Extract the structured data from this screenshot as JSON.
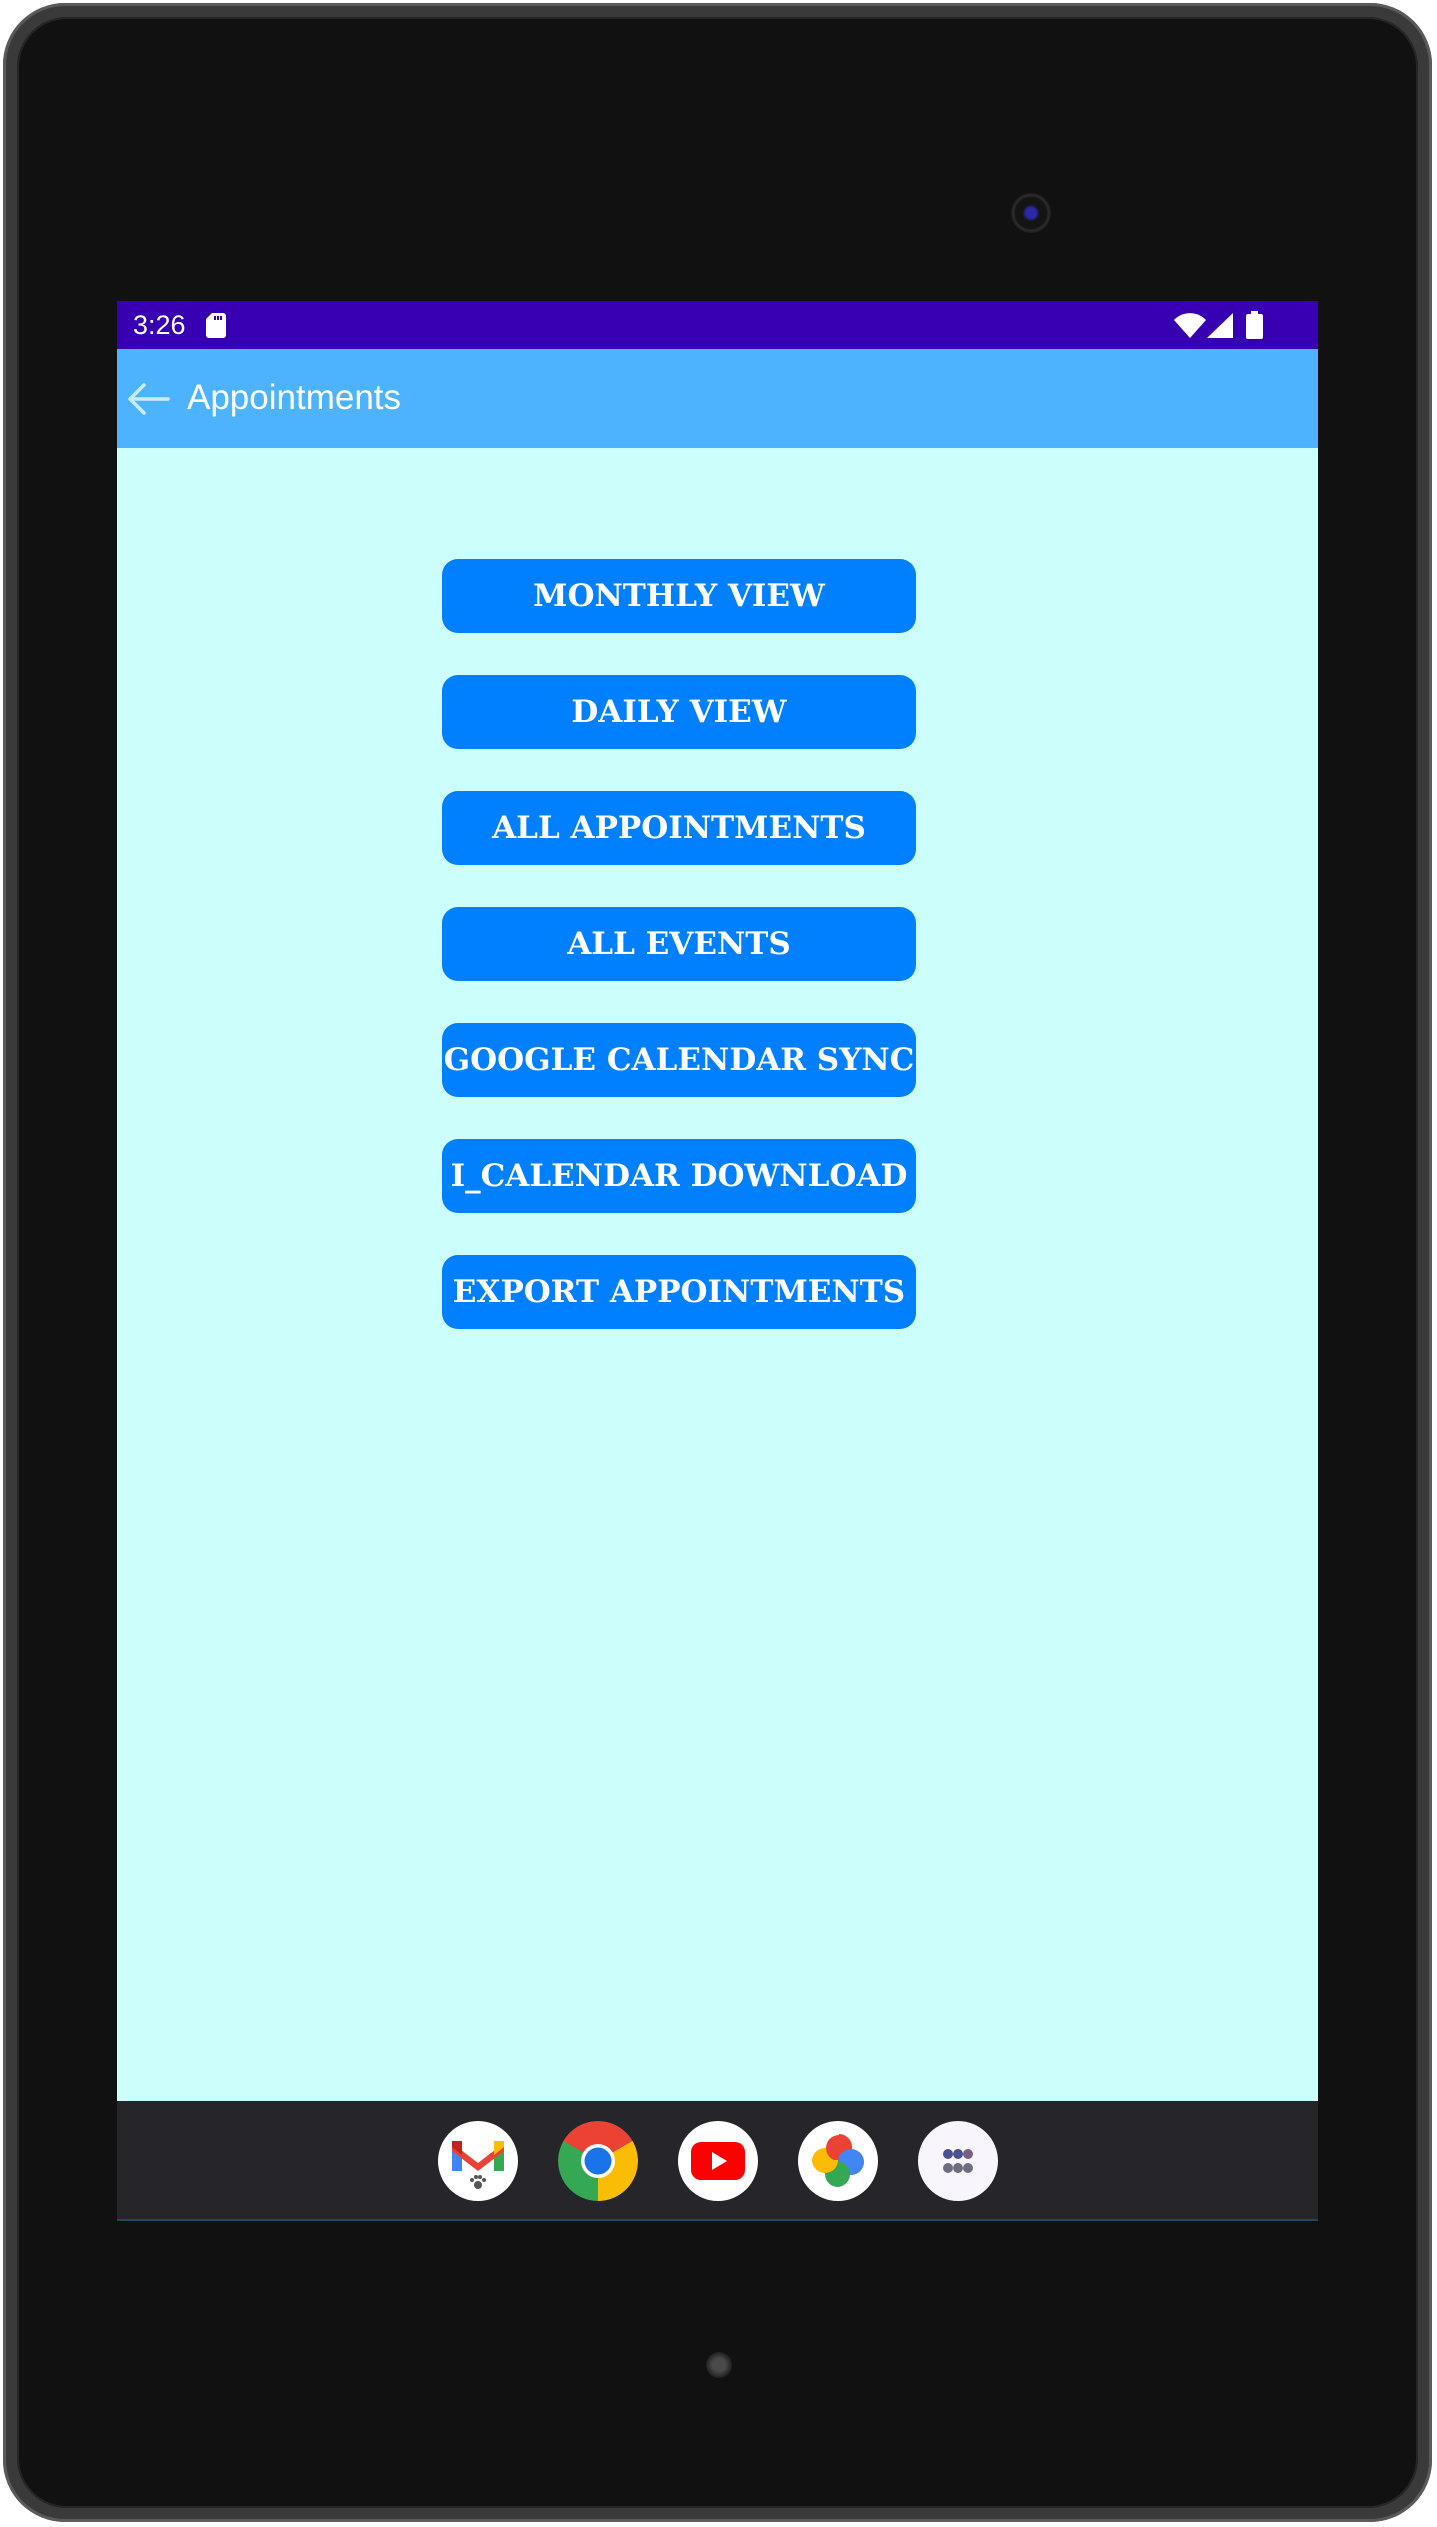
{
  "status_bar": {
    "time": "3:26",
    "icons": [
      "sd-card-icon",
      "wifi-icon",
      "signal-icon",
      "battery-icon"
    ]
  },
  "app_bar": {
    "back_icon": "arrow-left-icon",
    "title": "Appointments"
  },
  "menu": {
    "buttons": [
      {
        "label": "MONTHLY VIEW"
      },
      {
        "label": "DAILY VIEW"
      },
      {
        "label": "ALL APPOINTMENTS"
      },
      {
        "label": "ALL EVENTS"
      },
      {
        "label": "GOOGLE CALENDAR SYNC"
      },
      {
        "label": "I_CALENDAR DOWNLOAD"
      },
      {
        "label": "EXPORT APPOINTMENTS"
      }
    ]
  },
  "dock": {
    "apps": [
      {
        "name": "Gmail",
        "icon": "gmail-icon"
      },
      {
        "name": "Chrome",
        "icon": "chrome-icon"
      },
      {
        "name": "YouTube",
        "icon": "youtube-icon"
      },
      {
        "name": "Photos",
        "icon": "photos-icon"
      },
      {
        "name": "All apps",
        "icon": "app-drawer-icon"
      }
    ]
  },
  "colors": {
    "status_bar": "#3700b3",
    "app_bar": "#4db3ff",
    "background": "#ccfffc",
    "button": "#007fff",
    "button_text": "#ffffff",
    "dock": "#25252a"
  }
}
